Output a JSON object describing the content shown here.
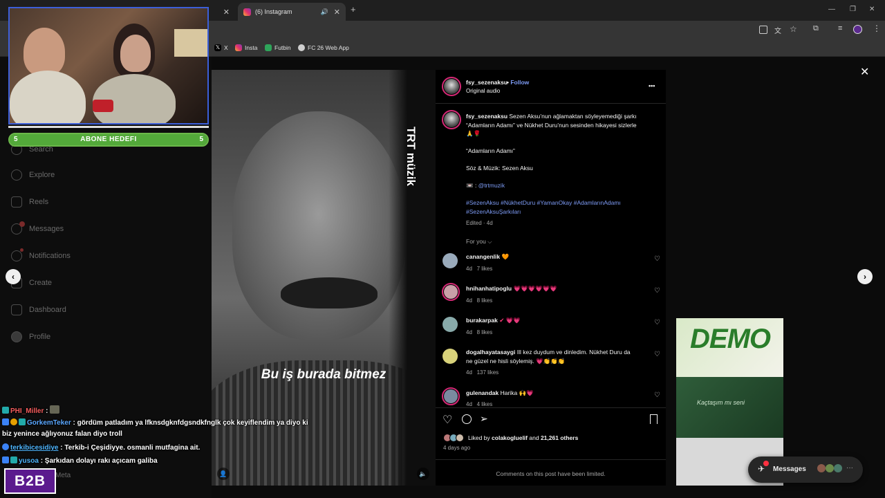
{
  "browser": {
    "active_tab_title": "(6) Instagram",
    "bookmarks": [
      "X",
      "Insta",
      "Futbin",
      "FC 26 Web App"
    ]
  },
  "stream": {
    "goal_label": "ABONE HEDEFI",
    "goal_current": "5",
    "goal_target": "5",
    "goal_progress": 1.0,
    "branding": "B2B"
  },
  "sidebar": {
    "items": [
      {
        "label": "Search"
      },
      {
        "label": "Explore"
      },
      {
        "label": "Reels"
      },
      {
        "label": "Messages"
      },
      {
        "label": "Notifications"
      },
      {
        "label": "Create"
      },
      {
        "label": "Dashboard"
      },
      {
        "label": "Profile"
      }
    ],
    "footer": "Meta"
  },
  "video": {
    "watermark": "TRT müzik",
    "subtitle": "Bu iş burada bitmez"
  },
  "post": {
    "username": "fsy_sezenaksu",
    "follow_label": "Follow",
    "audio": "Original audio",
    "more_icon": "•••",
    "caption_user": "fsy_sezenaksu",
    "caption_line1": "Sezen Aksu’nun ağlamaktan söyleyemediği şarkı",
    "caption_line2": "“Adamların Adamı” ve Nükhet Duru’nun sesinden hikayesi sizlerle",
    "caption_emojis": "🙏🌹",
    "song_title": "“Adamların Adamı”",
    "credits": "Söz & Müzik: Sezen Aksu",
    "source_prefix": "📼 :",
    "source_tag": "@trtmuzik",
    "hashtags_line1": "#SezenAksu #NükhetDuru #YamanOkay #AdamlarınAdamı",
    "hashtags_line2": "#SezenAksuŞarkıları",
    "edited": "Edited · 4d",
    "for_you": "For you ⌵",
    "comments": [
      {
        "user": "canangenlik",
        "text": "🧡",
        "time": "4d",
        "likes": "7 likes"
      },
      {
        "user": "hnihanhatipoglu",
        "text": "💗💗💗💗💗💗",
        "time": "4d",
        "likes": "8 likes"
      },
      {
        "user": "burakarpak",
        "text": "✔ 💗💗",
        "time": "4d",
        "likes": "8 likes"
      },
      {
        "user": "dogalhayatasaygi",
        "text": "Ill kez duydum ve dinledim. Nükhet Duru da",
        "text2": "ne güzel ne hisli söylemiş. 💗👏👏👏",
        "time": "4d",
        "likes": "137 likes"
      },
      {
        "user": "gulenandak",
        "text": "Harika 🙌💗",
        "time": "4d",
        "likes": "4 likes"
      }
    ],
    "liked_by_prefix": "Liked by",
    "liked_by_user": "colakogluelif",
    "liked_by_and": "and",
    "liked_by_others": "21,261 others",
    "date": "4 days ago",
    "limited_notice": "Comments on this post have been limited."
  },
  "backdrop": {
    "thumb_title": "DEMO",
    "thumb_caption": "Kaçtaşım mı seni",
    "messages_label": "Messages"
  },
  "chat": [
    {
      "user": "PHI_Miller",
      "message": ":"
    },
    {
      "user": "GorkemTeker",
      "message": ": gördüm patladım ya lfknsdgknfdgsndkfnglk çok keyiflendim ya diyo ki"
    },
    {
      "user": "",
      "message": "biz yenince ağlıyonuz falan diyo troll"
    },
    {
      "user": "terkibicesidiye",
      "message": ": Terkib-i Çeşidiyye. osmanli mutfagina ait."
    },
    {
      "user": "yusoa",
      "message": ": Şarkıdan dolayı rakı açıcam galiba"
    }
  ],
  "colors": {
    "accent_blue": "#7e9cf6",
    "heart_pink": "#ff3e7a",
    "story_ring": "#d62976",
    "goal_green": "#53a93a"
  }
}
